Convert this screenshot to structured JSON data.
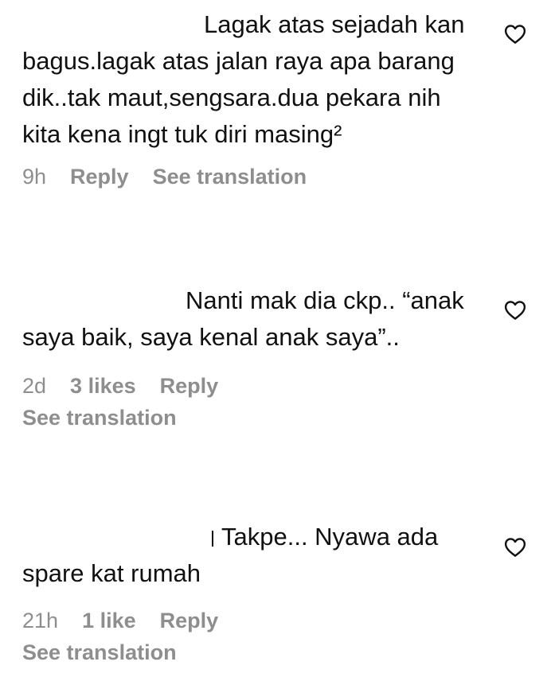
{
  "comments": [
    {
      "text": "Lagak atas sejadah kan bagus.lagak atas jalan raya apa barang dik..tak maut,sengsara.dua pekara nih kita kena ingt tuk diri masing²",
      "time": "9h",
      "likes": "",
      "reply_label": "Reply",
      "translation_label": "See translation",
      "icon": "heart-outline"
    },
    {
      "text": "Nanti mak dia ckp.. “anak saya baik, saya kenal anak saya”..",
      "time": "2d",
      "likes": "3 likes",
      "reply_label": "Reply",
      "translation_label": "See translation",
      "icon": "heart-outline"
    },
    {
      "text": "Takpe... Nyawa ada spare kat rumah",
      "time": "21h",
      "likes": "1 like",
      "reply_label": "Reply",
      "translation_label": "See translation",
      "icon": "heart-outline"
    }
  ],
  "colors": {
    "text": "#111111",
    "meta": "#8e8e8e",
    "background": "#ffffff"
  }
}
